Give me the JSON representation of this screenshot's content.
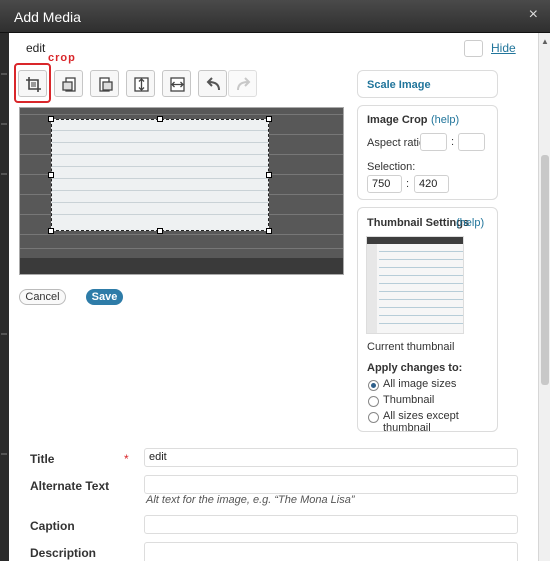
{
  "header": {
    "title": "Add Media",
    "close_icon": "×"
  },
  "editor": {
    "filename": "edit",
    "hide_label": "Hide",
    "crop_annotation": "crop",
    "tools": [
      {
        "name": "crop-tool",
        "icon": "crop-icon"
      },
      {
        "name": "rotate-left-tool",
        "icon": "rotate-ccw-icon"
      },
      {
        "name": "rotate-right-tool",
        "icon": "rotate-cw-icon"
      },
      {
        "name": "flip-vertical-tool",
        "icon": "flip-vertical-icon"
      },
      {
        "name": "flip-horizontal-tool",
        "icon": "flip-horizontal-icon"
      },
      {
        "name": "undo-tool",
        "icon": "undo-icon"
      },
      {
        "name": "redo-tool",
        "icon": "redo-icon"
      }
    ],
    "cancel_label": "Cancel",
    "save_label": "Save"
  },
  "sidebar": {
    "scale_image": {
      "title": "Scale Image"
    },
    "image_crop": {
      "title": "Image Crop",
      "help": "(help)",
      "aspect_ratio_label": "Aspect ratio:",
      "aspect_w": "",
      "aspect_h": "",
      "aspect_sep": ":",
      "selection_label": "Selection:",
      "selection_w": "750",
      "selection_h": "420",
      "selection_sep": ":"
    },
    "thumbnail_settings": {
      "title": "Thumbnail Settings",
      "help": "(help)",
      "current_thumbnail_label": "Current thumbnail",
      "apply_label": "Apply changes to:",
      "options": [
        "All image sizes",
        "Thumbnail",
        "All sizes except thumbnail"
      ],
      "selected_option": "All image sizes"
    }
  },
  "fields": {
    "title_label": "Title",
    "required_mark": "*",
    "title_value": "edit",
    "alt_text_label": "Alternate Text",
    "alt_text_value": "",
    "alt_text_help": "Alt text for the image, e.g. “The Mona Lisa”",
    "caption_label": "Caption",
    "caption_value": "",
    "description_label": "Description",
    "description_value": ""
  },
  "colors": {
    "accent": "#21759b",
    "save_button": "#2e7ca8",
    "annotation": "#d9262a"
  }
}
